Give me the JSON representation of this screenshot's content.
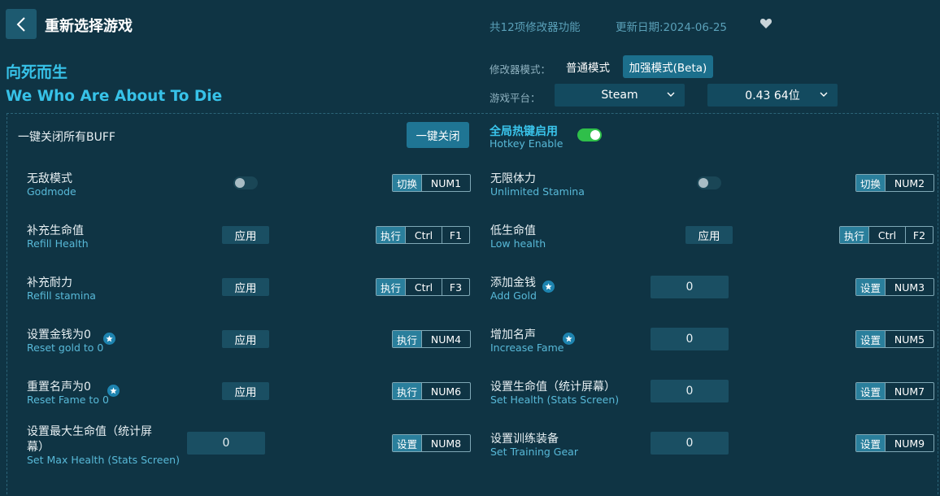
{
  "header": {
    "title": "重新选择游戏",
    "feature_count": "共12项修改器功能",
    "update_date": "更新日期:2024-06-25"
  },
  "game": {
    "name_cn": "向死而生",
    "name_en": "We Who Are About To Die"
  },
  "mode": {
    "label": "修改器模式：",
    "normal": "普通模式",
    "beta": "加强模式(Beta)",
    "selected": "加强模式(Beta)"
  },
  "platform": {
    "label": "游戏平台：",
    "platform_value": "Steam",
    "version_value": "0.43 64位"
  },
  "global": {
    "close_all_label": "一键关闭所有BUFF",
    "close_all_button": "一键关闭",
    "hotkey_cn": "全局热键启用",
    "hotkey_en": "Hotkey Enable",
    "hotkey_enabled": true
  },
  "features": [
    {
      "cn": "无敌模式",
      "en": "Godmode",
      "control": "toggle",
      "action": "切换",
      "keys": [
        "NUM1"
      ]
    },
    {
      "cn": "无限体力",
      "en": "Unlimited Stamina",
      "control": "toggle",
      "action": "切换",
      "keys": [
        "NUM2"
      ]
    },
    {
      "cn": "补充生命值",
      "en": "Refill Health",
      "control": "apply",
      "apply_label": "应用",
      "action": "执行",
      "keys": [
        "Ctrl",
        "F1"
      ]
    },
    {
      "cn": "低生命值",
      "en": "Low health",
      "control": "apply",
      "apply_label": "应用",
      "action": "执行",
      "keys": [
        "Ctrl",
        "F2"
      ]
    },
    {
      "cn": "补充耐力",
      "en": "Refill stamina",
      "control": "apply",
      "apply_label": "应用",
      "action": "执行",
      "keys": [
        "Ctrl",
        "F3"
      ]
    },
    {
      "cn": "添加金钱",
      "en": "Add Gold",
      "control": "input",
      "value": "0",
      "star": true,
      "action": "设置",
      "keys": [
        "NUM3"
      ]
    },
    {
      "cn": "设置金钱为0",
      "en": "Reset gold to 0",
      "control": "apply",
      "apply_label": "应用",
      "star": true,
      "action": "执行",
      "keys": [
        "NUM4"
      ]
    },
    {
      "cn": "增加名声",
      "en": "Increase Fame",
      "control": "input",
      "value": "0",
      "star": true,
      "action": "设置",
      "keys": [
        "NUM5"
      ]
    },
    {
      "cn": "重置名声为0",
      "en": "Reset Fame to 0",
      "control": "apply",
      "apply_label": "应用",
      "star": true,
      "action": "执行",
      "keys": [
        "NUM6"
      ]
    },
    {
      "cn": "设置生命值（统计屏幕）",
      "en": "Set Health (Stats Screen)",
      "control": "input",
      "value": "0",
      "action": "设置",
      "keys": [
        "NUM7"
      ]
    },
    {
      "cn_line1": "设置最大生命值（统计屏",
      "cn_line2": "幕）",
      "en": "Set Max Health (Stats Screen)",
      "control": "input",
      "value": "0",
      "action": "设置",
      "keys": [
        "NUM8"
      ]
    },
    {
      "cn": "设置训练装备",
      "en": "Set Training Gear",
      "control": "input",
      "value": "0",
      "action": "设置",
      "keys": [
        "NUM9"
      ]
    }
  ]
}
